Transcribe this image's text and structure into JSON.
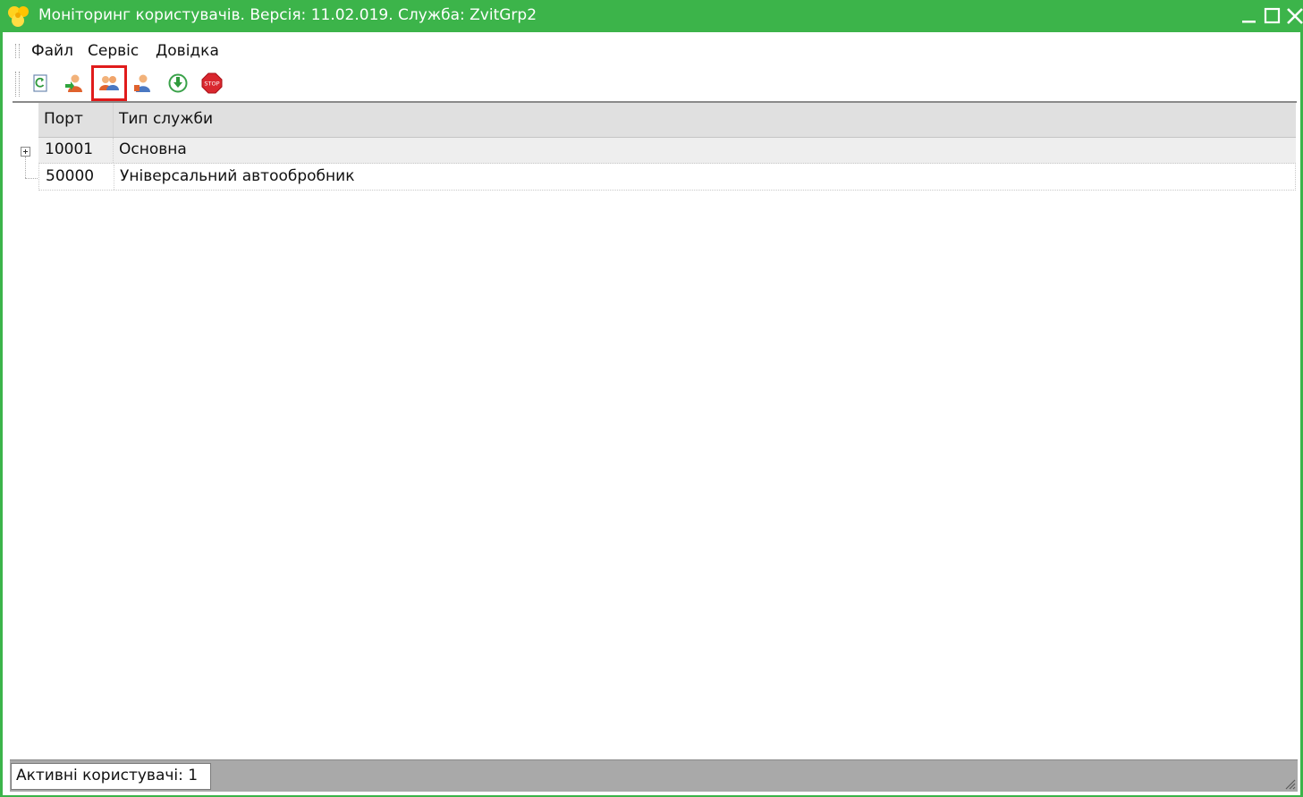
{
  "window": {
    "title": "Моніторинг користувачів. Версія: 11.02.019. Служба: ZvitGrp2",
    "accent_color": "#3cb44a",
    "controls": [
      "minimize-icon",
      "maximize-icon",
      "close-icon"
    ]
  },
  "menu": {
    "file": "Файл",
    "service": "Сервіс",
    "help": "Довідка"
  },
  "toolbar": {
    "buttons": [
      {
        "icon": "refresh-icon"
      },
      {
        "icon": "user-connect-icon"
      },
      {
        "icon": "users-group-icon",
        "selected": true,
        "highlight_color": "#e01b1b"
      },
      {
        "icon": "user-info-icon"
      },
      {
        "icon": "download-icon"
      },
      {
        "icon": "stop-icon",
        "label": "STOP"
      }
    ]
  },
  "grid": {
    "columns": [
      "Порт",
      "Тип служби"
    ],
    "rows": [
      {
        "port": "10001",
        "type": "Основна",
        "expandable": true
      },
      {
        "port": "50000",
        "type": "Універсальний автообробник",
        "expandable": false
      }
    ]
  },
  "status": {
    "active_users": "Активні користувачі: 1"
  }
}
